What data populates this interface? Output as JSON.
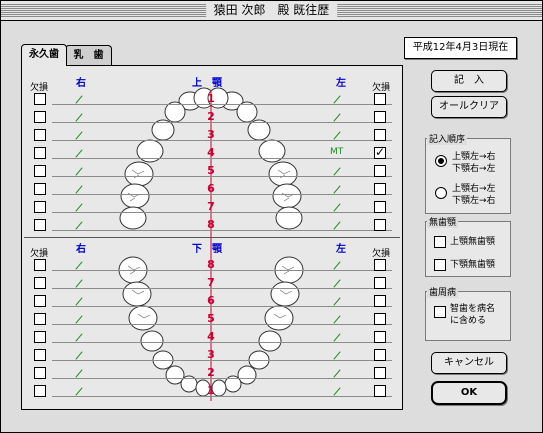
{
  "window": {
    "title": "猿田 次郎　殿 既往歴"
  },
  "date_label": "平成12年4月3日現在",
  "tabs": [
    {
      "label": "永久歯",
      "active": true
    },
    {
      "label": "乳　歯",
      "active": false
    }
  ],
  "upper": {
    "missing_label": "欠損",
    "right_label": "右",
    "jaw_label": "上　顎",
    "left_label": "左",
    "numbers": [
      "1",
      "2",
      "3",
      "4",
      "5",
      "6",
      "7",
      "8"
    ],
    "right_marks": [
      "/",
      "/",
      "/",
      "/",
      "/",
      "/",
      "/",
      "/"
    ],
    "left_marks": [
      "/",
      "/",
      "/",
      "MT",
      "/",
      "/",
      "/",
      "/"
    ],
    "right_checked": [
      false,
      false,
      false,
      false,
      false,
      false,
      false,
      false
    ],
    "left_checked": [
      false,
      false,
      false,
      true,
      false,
      false,
      false,
      false
    ]
  },
  "lower": {
    "missing_label": "欠損",
    "right_label": "右",
    "jaw_label": "下　顎",
    "left_label": "左",
    "numbers": [
      "8",
      "7",
      "6",
      "5",
      "4",
      "3",
      "2",
      "1"
    ],
    "right_marks": [
      "/",
      "/",
      "/",
      "/",
      "/",
      "/",
      "/",
      "/"
    ],
    "left_marks": [
      "/",
      "/",
      "/",
      "/",
      "/",
      "/",
      "/",
      "/"
    ],
    "right_checked": [
      false,
      false,
      false,
      false,
      false,
      false,
      false,
      false
    ],
    "left_checked": [
      false,
      false,
      false,
      false,
      false,
      false,
      false,
      false
    ]
  },
  "buttons": {
    "enter": "記　入",
    "all_clear": "オールクリア",
    "cancel": "キャンセル",
    "ok": "OK"
  },
  "entry_order": {
    "title": "記入順序",
    "option1_line1": "上顎左→右",
    "option1_line2": "下顎右→左",
    "option2_line1": "上顎右→左",
    "option2_line2": "下顎左→右",
    "selected": 1
  },
  "edentulous": {
    "title": "無歯顎",
    "upper": "上顎無歯顎",
    "lower": "下顎無歯顎",
    "upper_checked": false,
    "lower_checked": false
  },
  "periodontal": {
    "title": "歯周病",
    "line1": "智歯を病名",
    "line2": "に含める",
    "checked": false
  },
  "colors": {
    "accent_red": "#cc0033",
    "label_blue": "#0000cc",
    "mark_green": "#1d8a1d"
  }
}
